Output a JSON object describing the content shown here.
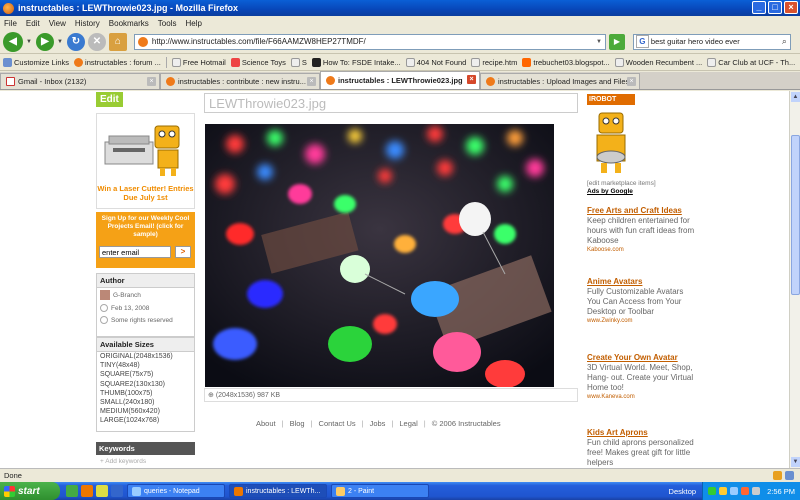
{
  "window": {
    "title": "instructables : LEWThrowie023.jpg - Mozilla Firefox"
  },
  "menu": [
    "File",
    "Edit",
    "View",
    "History",
    "Bookmarks",
    "Tools",
    "Help"
  ],
  "url": "http://www.instructables.com/file/F66AAMZW8HEP27TMDF/",
  "search": {
    "value": "best guitar hero video ever"
  },
  "bookmarks": [
    "Customize Links",
    "instructables : forum ...",
    "Free Hotmail",
    "Science Toys",
    "S",
    "How To: FSDE Intake...",
    "404 Not Found",
    "recipe.htm",
    "trebuchet03.blogspot...",
    "Wooden Recumbent ...",
    "Car Club at UCF - Th..."
  ],
  "tabs": [
    {
      "label": "Gmail - Inbox (2132)",
      "icon": "gmail-icon"
    },
    {
      "label": "instructables : contribute : new instru...",
      "icon": "instructables-icon"
    },
    {
      "label": "instructables : LEWThrowie023.jpg",
      "icon": "instructables-icon"
    },
    {
      "label": "instructables : Upload Images and Files",
      "icon": "instructables-icon"
    }
  ],
  "page": {
    "edit_label": "Edit",
    "promo_text": "Win a Laser Cutter! Entries Due July 1st",
    "signup_text": "Sign Up for our Weekly Cool Projects Email! (click for sample)",
    "signup_placeholder": "enter email",
    "signup_button": ">",
    "author_header": "Author",
    "author_name": "G-Branch",
    "author_date": "Feb 13, 2008",
    "author_rights": "Some rights reserved",
    "sizes_header": "Available Sizes",
    "sizes": [
      "ORIGINAL(2048x1536)",
      "TINY(48x48)",
      "SQUARE(75x75)",
      "SQUARE2(130x130)",
      "THUMB(100x75)",
      "SMALL(240x180)",
      "MEDIUM(560x420)",
      "LARGE(1024x768)"
    ],
    "keywords_header": "Keywords",
    "keywords_add": "+ Add keywords",
    "photo_title": "LEWThrowie023.jpg",
    "photo_meta": "(2048x1536) 987 KB",
    "footer": [
      "About",
      "Blog",
      "Contact Us",
      "Jobs",
      "Legal",
      "© 2006 Instructables"
    ],
    "irobot_label": "IROBOT CHALLENGE",
    "marketplace_edit": "[edit marketplace items]",
    "ads_by": "Ads by Google",
    "ads": [
      {
        "title": "Free Arts and Craft Ideas",
        "desc": "Keep children entertained for hours with fun craft ideas from Kaboose",
        "url": "Kaboose.com"
      },
      {
        "title": "Anime Avatars",
        "desc": "Fully Customizable Avatars You Can Access from Your Desktop or Toolbar",
        "url": "www.Zwinky.com"
      },
      {
        "title": "Create Your Own Avatar",
        "desc": "3D Virtual World. Meet, Shop, Hang- out. Create your Virtual Home too!",
        "url": "www.Kaneva.com"
      },
      {
        "title": "Kids Art Aprons",
        "desc": "Fun child aprons personalized free! Makes great gift for little helpers",
        "url": ""
      }
    ]
  },
  "status": "Done",
  "taskbar": {
    "start": "start",
    "tasks": [
      "queries - Notepad",
      "instructables : LEWTh...",
      "2 - Paint"
    ],
    "desktop": "Desktop",
    "clock": "2:56 PM"
  }
}
